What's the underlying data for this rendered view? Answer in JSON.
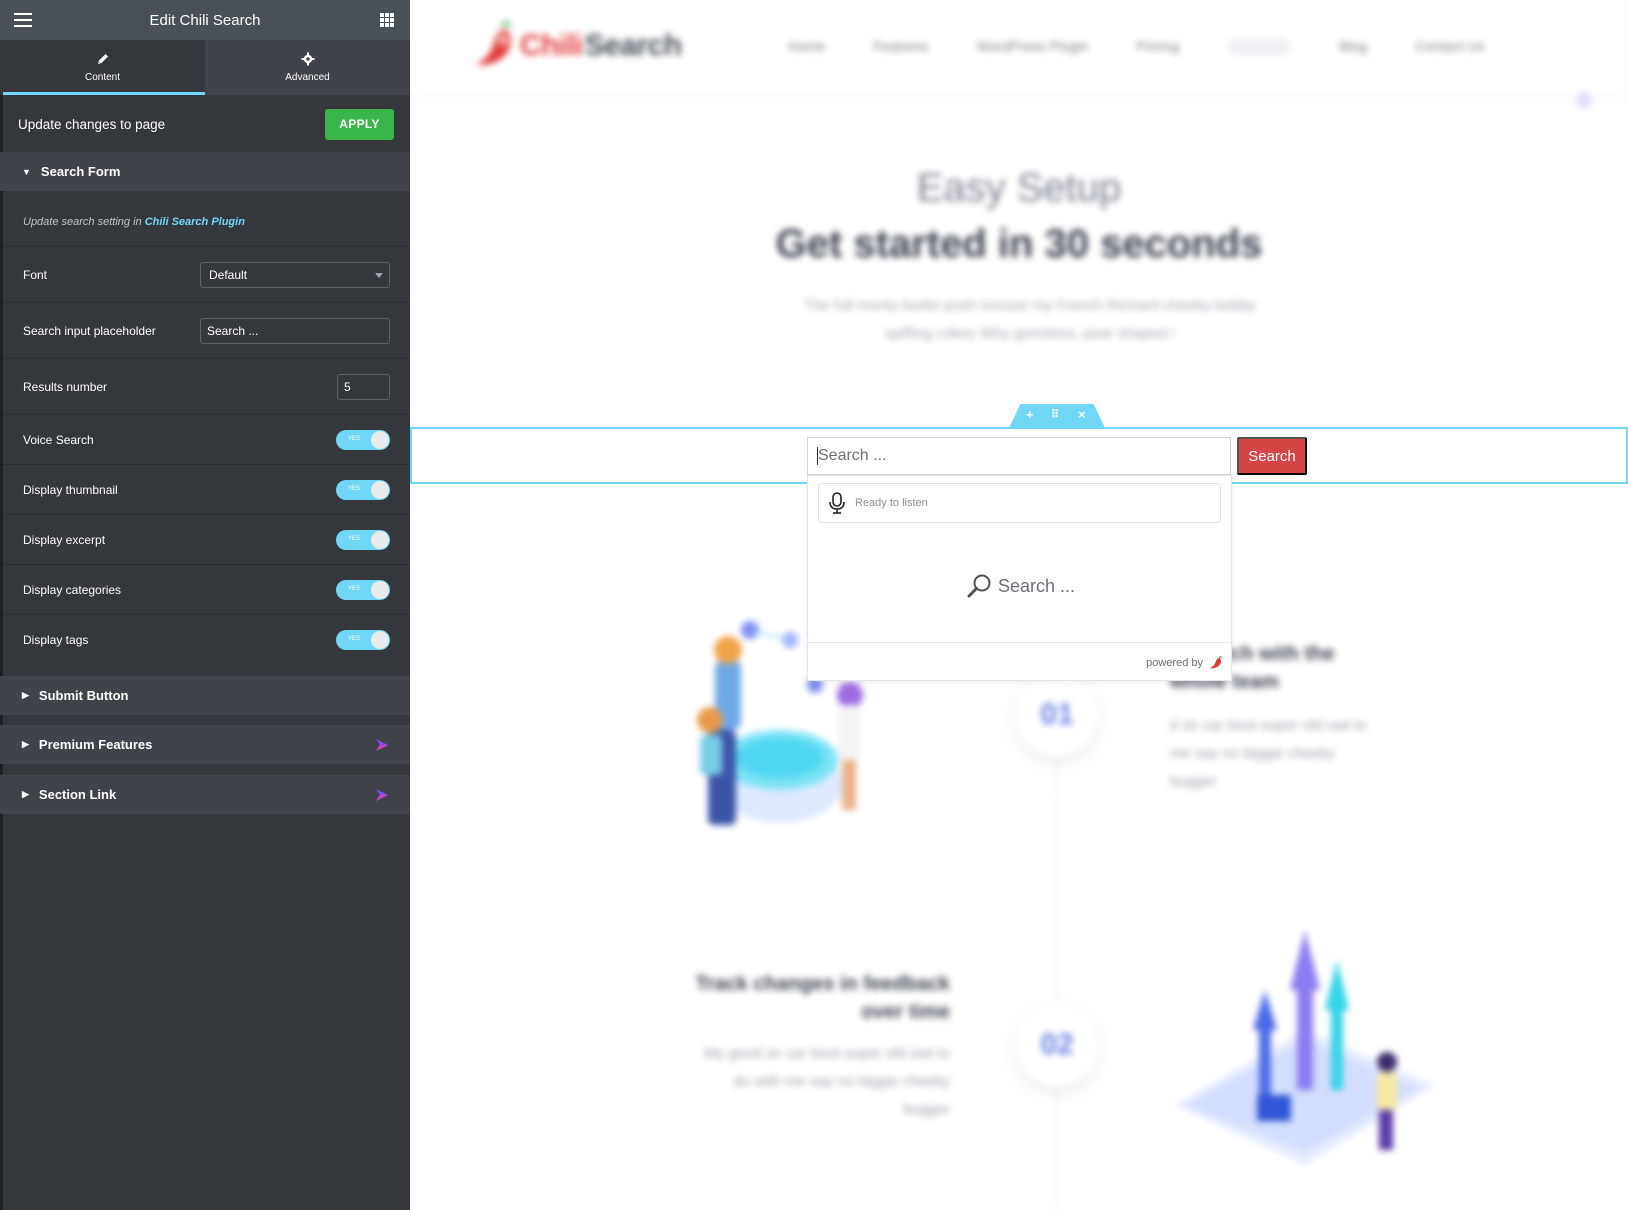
{
  "panel": {
    "title": "Edit Chili Search",
    "tabs": [
      {
        "label": "Content",
        "icon": "pencil-icon",
        "active": true
      },
      {
        "label": "Advanced",
        "icon": "gear-icon",
        "active": false
      }
    ],
    "apply_row": {
      "label": "Update changes to page",
      "button": "APPLY"
    },
    "search_form": {
      "heading": "Search Form",
      "hint_prefix": "Update search setting in ",
      "hint_link": "Chili Search Plugin",
      "font": {
        "label": "Font",
        "value": "Default"
      },
      "placeholder": {
        "label": "Search input placeholder",
        "value": "Search ..."
      },
      "results": {
        "label": "Results number",
        "value": "5"
      },
      "toggles": [
        {
          "label": "Voice Search",
          "state": "YES"
        },
        {
          "label": "Display thumbnail",
          "state": "YES"
        },
        {
          "label": "Display excerpt",
          "state": "YES"
        },
        {
          "label": "Display categories",
          "state": "YES"
        },
        {
          "label": "Display tags",
          "state": "YES"
        }
      ]
    },
    "sections": [
      {
        "label": "Submit Button",
        "pro": false
      },
      {
        "label": "Premium Features",
        "pro": true
      },
      {
        "label": "Section Link",
        "pro": true
      }
    ],
    "accent": "#71d7f7",
    "apply_color": "#39b54a"
  },
  "site": {
    "logo_word1": "Chili",
    "logo_word2": "Search",
    "nav": [
      "Home",
      "Features",
      "WordPress Plugin",
      "Pricing",
      "Blog",
      "Contact Us"
    ],
    "hero_title": "Easy Setup",
    "hero_subtitle": "Get started in 30 seconds",
    "hero_text1": "The full monty burke posh excuse my French Richard cheeky bobby",
    "hero_text2": "spiffing crikey Why gormless, pear shaped.!",
    "features": [
      {
        "num": "01",
        "title1": "research with the",
        "title2": "whole team",
        "text1": "d sir car boot super old owt to",
        "text2": "me say no biggie cheeky",
        "text3": "bugger"
      },
      {
        "num": "02",
        "title1": "Track changes in feedback",
        "title2": "over time",
        "text1": "My good sir car boot super old owt to",
        "text2": "do with me say no biggie cheeky",
        "text3": "bugger"
      }
    ]
  },
  "widget": {
    "input_value": "Search ...",
    "button": "Search",
    "voice_label": "Ready to listen",
    "dropdown_search": "Search ...",
    "powered_by": "powered by",
    "button_color": "#d64545"
  }
}
